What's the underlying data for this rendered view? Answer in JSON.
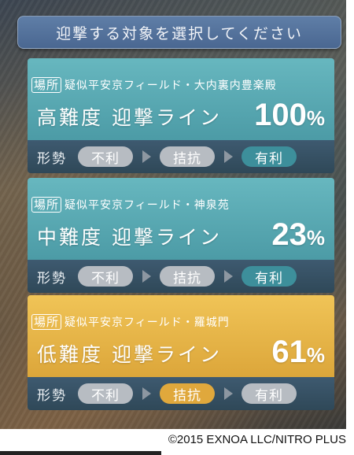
{
  "prompt": "迎撃する対象を選択してください",
  "cards": [
    {
      "theme": "teal",
      "location_tag": "場所",
      "location": "疑似平安京フィールド・大内裏内豊楽殿",
      "difficulty": "高難度 迎撃ライン",
      "percent": "100",
      "percent_sign": "%",
      "situation_label": "形勢",
      "states": [
        "不利",
        "拮抗",
        "有利"
      ],
      "active_state": 2
    },
    {
      "theme": "teal",
      "location_tag": "場所",
      "location": "疑似平安京フィールド・神泉苑",
      "difficulty": "中難度 迎撃ライン",
      "percent": "23",
      "percent_sign": "%",
      "situation_label": "形勢",
      "states": [
        "不利",
        "拮抗",
        "有利"
      ],
      "active_state": 2
    },
    {
      "theme": "gold",
      "location_tag": "場所",
      "location": "疑似平安京フィールド・羅城門",
      "difficulty": "低難度 迎撃ライン",
      "percent": "61",
      "percent_sign": "%",
      "situation_label": "形勢",
      "states": [
        "不利",
        "拮抗",
        "有利"
      ],
      "active_state": 1
    }
  ],
  "copyright": "©2015 EXNOA LLC/NITRO PLUS",
  "colors": {
    "teal_card": "#5aaab3",
    "gold_card": "#e8b64a",
    "footer": "#34506a",
    "inactive_pill": "#b7bcc2"
  }
}
